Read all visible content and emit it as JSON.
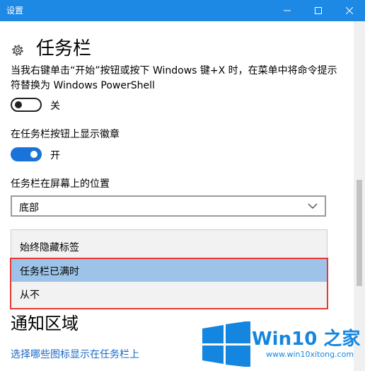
{
  "window": {
    "title": "设置"
  },
  "header": {
    "title": "任务栏"
  },
  "powershell": {
    "description": "当我右键单击“开始”按钮或按下 Windows 键+X 时，在菜单中将命令提示符替换为 Windows PowerShell",
    "state_label": "关",
    "on": false
  },
  "badges": {
    "label": "在任务栏按钮上显示徽章",
    "state_label": "开",
    "on": true
  },
  "position": {
    "label": "任务栏在屏幕上的位置",
    "value": "底部"
  },
  "combine_dropdown": {
    "options": [
      "始终隐藏标签",
      "任务栏已满时",
      "从不"
    ],
    "highlighted": "任务栏已满时"
  },
  "notification": {
    "section_title": "通知区域",
    "link": "选择哪些图标显示在任务栏上"
  },
  "watermark": {
    "brand": "Win10 之家",
    "url": "www.win10xitong.com"
  },
  "colors": {
    "titlebar": "#1e88e5",
    "accent": "#1a73d9",
    "highlight": "#9dc4e8",
    "annotation": "#e53935",
    "link": "#1a66c8"
  }
}
